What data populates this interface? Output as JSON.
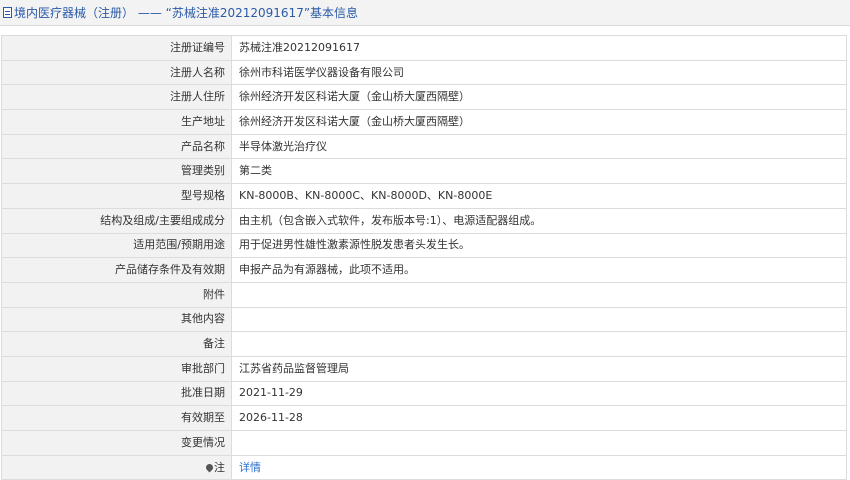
{
  "header": {
    "title": "境内医疗器械（注册） —— “苏械注准20212091617”基本信息"
  },
  "rows": [
    {
      "label": "注册证编号",
      "value": "苏械注准20212091617"
    },
    {
      "label": "注册人名称",
      "value": "徐州市科诺医学仪器设备有限公司"
    },
    {
      "label": "注册人住所",
      "value": "徐州经济开发区科诺大厦（金山桥大厦西隔壁）"
    },
    {
      "label": "生产地址",
      "value": "徐州经济开发区科诺大厦（金山桥大厦西隔壁）"
    },
    {
      "label": "产品名称",
      "value": "半导体激光治疗仪"
    },
    {
      "label": "管理类别",
      "value": "第二类"
    },
    {
      "label": "型号规格",
      "value": "KN-8000B、KN-8000C、KN-8000D、KN-8000E"
    },
    {
      "label": "结构及组成/主要组成成分",
      "value": "由主机（包含嵌入式软件，发布版本号:1）、电源适配器组成。"
    },
    {
      "label": "适用范围/预期用途",
      "value": "用于促进男性雄性激素源性脱发患者头发生长。"
    },
    {
      "label": "产品储存条件及有效期",
      "value": "申报产品为有源器械，此项不适用。"
    },
    {
      "label": "附件",
      "value": ""
    },
    {
      "label": "其他内容",
      "value": ""
    },
    {
      "label": "备注",
      "value": ""
    },
    {
      "label": "审批部门",
      "value": "江苏省药品监督管理局"
    },
    {
      "label": "批准日期",
      "value": "2021-11-29"
    },
    {
      "label": "有效期至",
      "value": "2026-11-28"
    },
    {
      "label": "变更情况",
      "value": ""
    }
  ],
  "note_row": {
    "label": "注",
    "link_text": "详情"
  }
}
